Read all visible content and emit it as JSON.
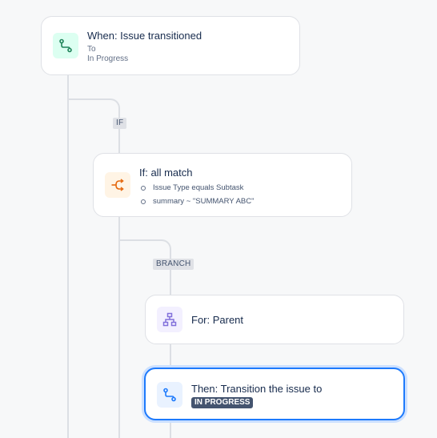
{
  "trigger": {
    "title": "When: Issue transitioned",
    "to_label": "To",
    "status": "In Progress",
    "icon": "transition-icon",
    "icon_bg": "#dcfff1",
    "icon_color": "#1f845a"
  },
  "if_chip": "IF",
  "condition": {
    "title": "If: all match",
    "items": [
      "Issue Type equals Subtask",
      "summary ~ \"SUMMARY ABC\""
    ],
    "icon": "condition-branch-icon",
    "icon_bg": "#fff4e5",
    "icon_color": "#e56910"
  },
  "branch_chip": "BRANCH",
  "branch": {
    "title": "For: Parent",
    "icon": "hierarchy-icon",
    "icon_bg": "#f3f0ff",
    "icon_color": "#8270db"
  },
  "action": {
    "title": "Then: Transition the issue to",
    "status": "IN PROGRESS",
    "icon": "transition-icon",
    "icon_bg": "#e9f2ff",
    "icon_color": "#1d7afc"
  },
  "colors": {
    "selected_border": "#1d7afc",
    "connector": "#dcdfe4"
  }
}
